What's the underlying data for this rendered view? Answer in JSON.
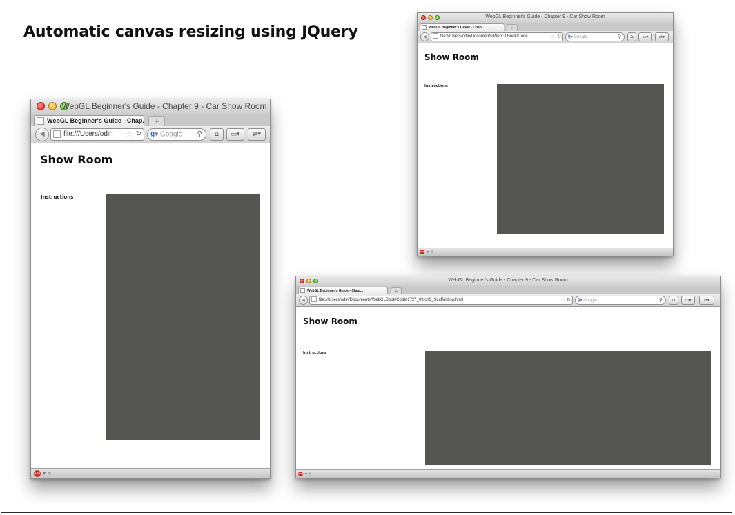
{
  "slide": {
    "title": "Automatic canvas resizing using JQuery"
  },
  "browser": {
    "window_title": "WebGL Beginner's Guide - Chapter 9 - Car Show Room",
    "tab_label": "WebGL Beginner's Guide - Chap...",
    "new_tab_symbol": "+",
    "url_short": "file:///Users/odin",
    "url_medium": "file:///Users/odin/Documents/WebGLBook/Code",
    "url_full": "file:///Users/odin/Documents/WebGLBook/Code/1727_09/ch9_Scaffolding.html",
    "search_placeholder": "Google",
    "page_heading": "Show Room",
    "instructions_label": "Instructions",
    "status_glyphs": "▾ ×",
    "abp_label": "ABP"
  },
  "colors": {
    "canvas": "#555552",
    "window_chrome": "#d6d6d6",
    "close_light": "#d6251c",
    "minimize_light": "#e0a21a",
    "zoom_light": "#4fa62a"
  },
  "icons": {
    "back": "back-arrow-icon",
    "bookmark": "star-icon",
    "reload": "reload-icon",
    "search": "magnifier-icon",
    "home": "home-icon",
    "bookmarks_menu": "bookmarks-menu-icon",
    "pinned": "pin-icon",
    "adblock": "adblock-plus-icon"
  }
}
